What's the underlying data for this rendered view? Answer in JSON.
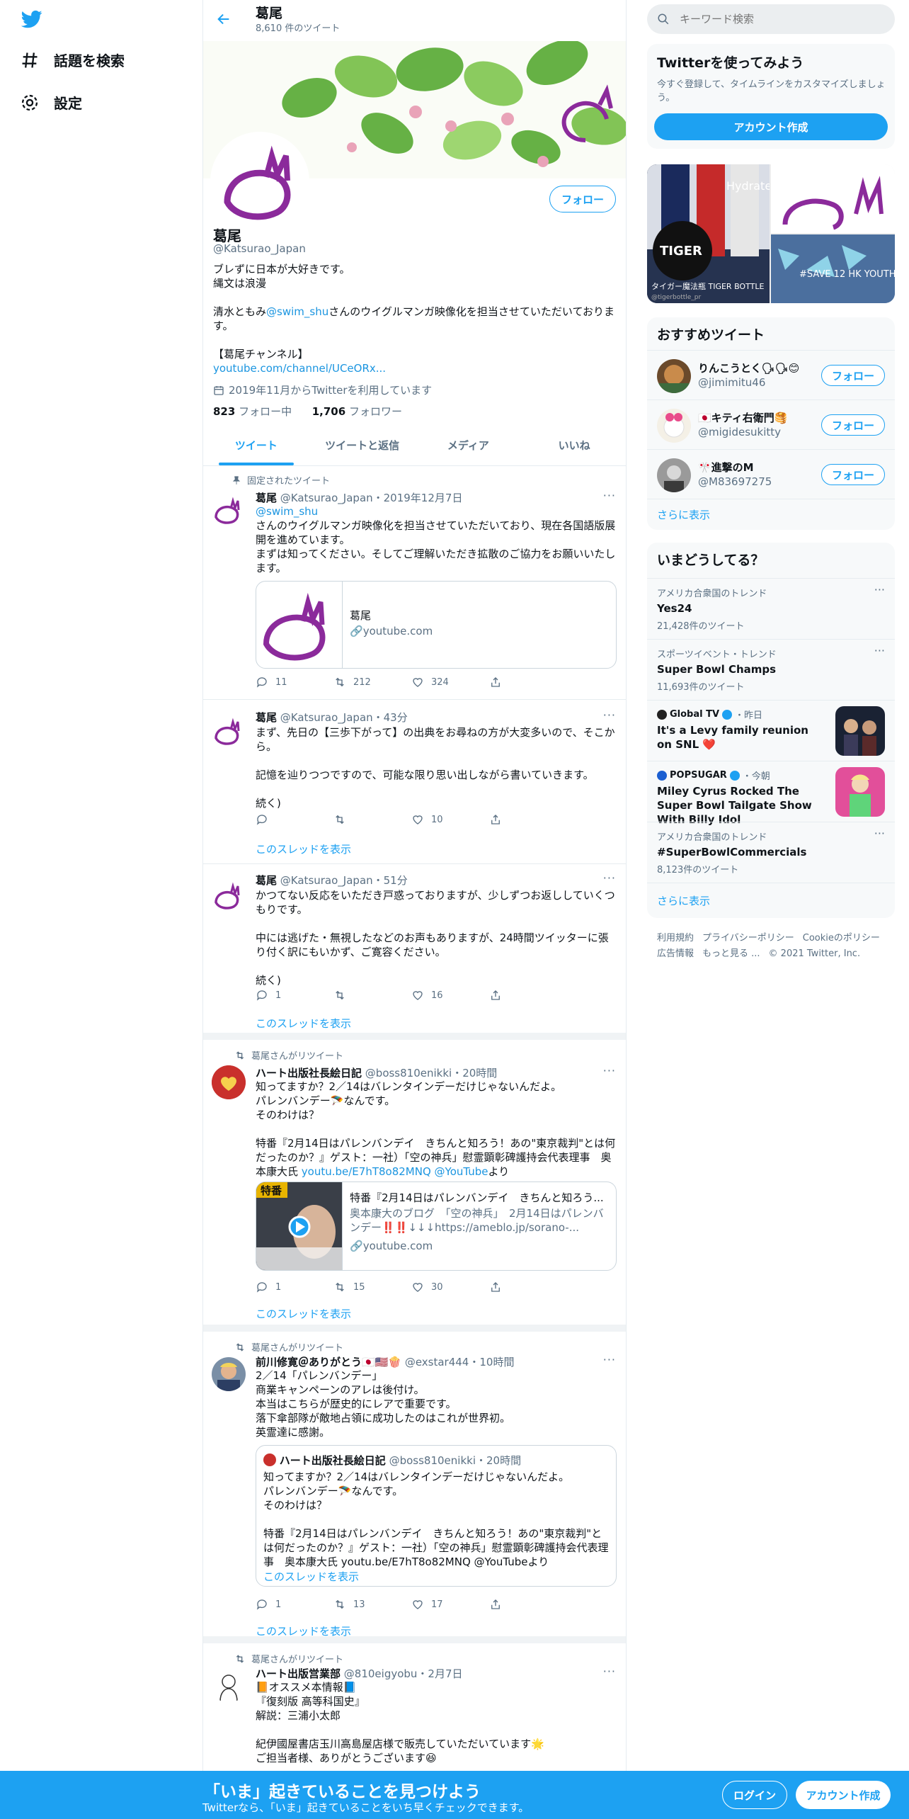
{
  "nav": {
    "explore": "話題を検索",
    "settings": "設定"
  },
  "header": {
    "name": "葛尾",
    "tweet_count": "8,610 件のツイート"
  },
  "profile": {
    "follow": "フォロー",
    "name": "葛尾",
    "handle": "@Katsurao_Japan",
    "bio1": "ブレずに日本が大好きです。\n縄文は浪漫",
    "bio2a": "清水ともみ",
    "bio2link": "@swim_shu",
    "bio2b": "さんのウイグルマンガ映像化を担当させていただいております。",
    "bio3": "【葛尾チャンネル】",
    "bio3link": "youtube.com/channel/UCeORx...",
    "joined": "2019年11月からTwitterを利用しています",
    "following": "823",
    "following_label": "フォロー中",
    "followers": "1,706",
    "followers_label": "フォロワー"
  },
  "tabs": [
    "ツイート",
    "ツイートと返信",
    "メディア",
    "いいね"
  ],
  "tweets": [
    {
      "context": "固定されたツイート",
      "name": "葛尾",
      "meta": "@Katsurao_Japan・2019年12月7日",
      "mention": "@swim_shu",
      "text": " さんのウイグルマンガ映像化を担当させていただいており、現在各国語版展開を進めています。\nまずは知ってください。そしてご理解いただき拡散のご協力をお願いいたします。",
      "card_title": "葛尾",
      "card_domain": "youtube.com",
      "replies": "11",
      "retweets": "212",
      "likes": "324"
    },
    {
      "name": "葛尾",
      "meta": "@Katsurao_Japan・43分",
      "text": "まず、先日の【三歩下がって】の出典をお尋ねの方が大変多いので、そこから。\n\n記憶を辿りつつですので、可能な限り思い出しながら書いていきます。\n\n続く)",
      "replies": "",
      "retweets": "",
      "likes": "10",
      "show": "このスレッドを表示"
    },
    {
      "name": "葛尾",
      "meta": "@Katsurao_Japan・51分",
      "text": "かつてない反応をいただき戸惑っておりますが、少しずつお返ししていくつもりです。\n\n中には逃げた・無視したなどのお声もありますが、24時間ツイッターに張り付く訳にもいかず、ご寛容ください。\n\n続く)",
      "replies": "1",
      "retweets": "",
      "likes": "16",
      "show": "このスレッドを表示"
    },
    {
      "context": "葛尾さんがリツイート",
      "name": "ハート出版社長絵日記",
      "meta": "@boss810enikki・20時間",
      "text": "知ってますか？2／14はバレンタインデーだけじゃないんだよ。\nパレンバンデー🪂なんです。\nそのわけは？\n\n特番『2月14日はパレンバンデイ　きちんと知ろう！あの\"東京裁判\"とは何だったのか？』ゲスト：一社）「空の神兵」慰霊顕彰碑護持会代表理事　奥本康大氏 ",
      "link": "youtu.be/E7hT8o82MNQ @YouTube",
      "link_after": "より",
      "card_title": "特番『2月14日はパレンバンデイ　きちんと知ろう...",
      "card_desc": "奥本康大のブログ　「空の神兵」　2月14日はパレンバンデー‼️‼️↓↓↓https://ameblo.jp/sorano-...",
      "card_domain": "youtube.com",
      "thumb_label": "特番",
      "replies": "1",
      "retweets": "15",
      "likes": "30",
      "show": "このスレッドを表示"
    },
    {
      "context": "葛尾さんがリツイート",
      "name": "前川修寛＠ありがとう🇯🇵🇺🇸🍿",
      "meta": "@exstar444・10時間",
      "text": "2／14「パレンバンデー」\n商業キャンペーンのアレは後付け。\n本当はこちらが歴史的にレアで重要です。\n落下傘部隊が敵地占領に成功したのはこれが世界初。\n英霊達に感謝。",
      "quote_name": "ハート出版社長絵日記",
      "quote_meta": "@boss810enikki・20時間",
      "quote_text": "知ってますか？2／14はバレンタインデーだけじゃないんだよ。\nパレンバンデー🪂なんです。\nそのわけは？\n\n特番『2月14日はパレンバンデイ　きちんと知ろう！あの\"東京裁判\"とは何だったのか？』ゲスト：一社）「空の神兵」慰霊顕彰碑護持会代表理事　奥本康大氏 youtu.be/E7hT8o82MNQ @YouTubeより",
      "quote_show": "このスレッドを表示",
      "replies": "1",
      "retweets": "13",
      "likes": "17",
      "show": "このスレッドを表示"
    },
    {
      "context": "葛尾さんがリツイート",
      "name": "ハート出版営業部",
      "meta": "@810eigyobu・2月7日",
      "text": "📙オススメ本情報📘\n『復刻版 高等科国史』\n解説：三浦小太郎\n\n紀伊國屋書店玉川高島屋店様で販売していただいています🌟\nご担当者様、ありがとうございます😆"
    }
  ],
  "search": {
    "placeholder": "キーワード検索"
  },
  "signup_box": {
    "title": "Twitterを使ってみよう",
    "sub": "今すぐ登録して、タイムラインをカスタマイズしましょう。",
    "button": "アカウント作成"
  },
  "media": {
    "tiger_brand": "TIGER",
    "tiger_hydrate": "Hydrate",
    "tiger_caption": "タイガー魔法瓶 TIGER BOTTLE",
    "tiger_handle": "@tigerbottle_pr",
    "hk_text": "#SAVE 12 HK YOUTH"
  },
  "recommend": {
    "title": "おすすめツイート",
    "follow": "フォロー",
    "more": "さらに表示",
    "items": [
      {
        "name": "りんこうとく🗣🗣😊",
        "handle": "@jimimitu46"
      },
      {
        "name": "🇯🇵キティ右衛門🥞",
        "handle": "@migidesukitty"
      },
      {
        "name": "🎌進撃のM",
        "handle": "@M83697275"
      }
    ]
  },
  "trends": {
    "title": "いまどうしてる？",
    "more": "さらに表示",
    "items": [
      {
        "ctx": "アメリカ合衆国のトレンド",
        "title": "Yes24",
        "count": "21,428件のツイート"
      },
      {
        "ctx": "スポーツイベント・トレンド",
        "title": "Super Bowl Champs",
        "count": "11,693件のツイート"
      },
      {
        "ctx": "Global TV",
        "ctx2": "・昨日",
        "title": "It's a Levy family reunion on SNL ❤️"
      },
      {
        "ctx": "POPSUGAR",
        "ctx2": "・今朝",
        "title": "Miley Cyrus Rocked The Super Bowl Tailgate Show With Billy Idol"
      },
      {
        "ctx": "アメリカ合衆国のトレンド",
        "title": "#SuperBowlCommercials",
        "count": "8,123件のツイート"
      }
    ]
  },
  "footer": {
    "terms": "利用規約",
    "privacy": "プライバシーポリシー",
    "cookie": "Cookieのポリシー",
    "ads": "広告情報",
    "more": "もっと見る ...",
    "copy": "© 2021 Twitter, Inc."
  },
  "bottom": {
    "title": "「いま」起きていることを見つけよう",
    "sub": "Twitterなら、「いま」起きていることをいち早くチェックできます。",
    "login": "ログイン",
    "signup": "アカウント作成"
  },
  "colors": {
    "accent": "#1da1f2",
    "logo_purple": "#8b2a9b"
  }
}
